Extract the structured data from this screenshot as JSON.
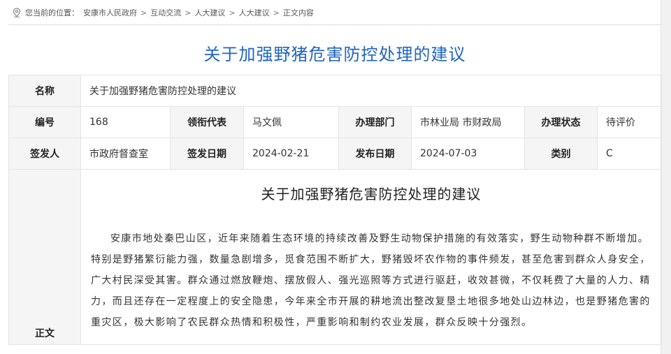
{
  "breadcrumb": {
    "prefix": "您当前的位置：",
    "items": [
      "安康市人民政府",
      "互动交流",
      "人大建议",
      "人大建议",
      "正文内容"
    ],
    "separator": ">"
  },
  "page_title": "关于加强野猪危害防控处理的建议",
  "info": {
    "name_label": "名称",
    "name_value": "关于加强野猪危害防控处理的建议",
    "number_label": "编号",
    "number_value": "168",
    "lead_rep_label": "领衔代表",
    "lead_rep_value": "马文佩",
    "dept_label": "办理部门",
    "dept_value": "市林业局 市财政局",
    "status_label": "办理状态",
    "status_value": "待评价",
    "issuer_label": "签发人",
    "issuer_value": "市政府督查室",
    "issue_date_label": "签发日期",
    "issue_date_value": "2024-02-21",
    "publish_date_label": "发布日期",
    "publish_date_value": "2024-07-03",
    "category_label": "类别",
    "category_value": "C",
    "body_label": "正文"
  },
  "article": {
    "title": "关于加强野猪危害防控处理的建议",
    "paragraph": "安康市地处秦巴山区，近年来随着生态环境的持续改善及野生动物保护措施的有效落实，野生动物种群不断增加。特别是野猪繁衍能力强，数量急剧增多，觅食范围不断扩大，野猪毁坏农作物的事件频发，甚至危害到群众人身安全，广大村民深受其害。群众通过燃放鞭炮、摆放假人、强光巡照等方式进行驱赶，收效甚微，不仅耗费了大量的人力、精力，而且还存在一定程度上的安全隐患，今年来全市开展的耕地流出整改复垦土地很多地处山边林边，也是野猪危害的重灾区，极大影响了农民群众热情和积极性，严重影响和制约农业发展，群众反映十分强烈。"
  },
  "colors": {
    "title_blue": "#1f64c2",
    "label_bg": "#f5f5f5",
    "border": "#e4e4e4"
  },
  "icons": {
    "location": "location-pin-icon"
  }
}
